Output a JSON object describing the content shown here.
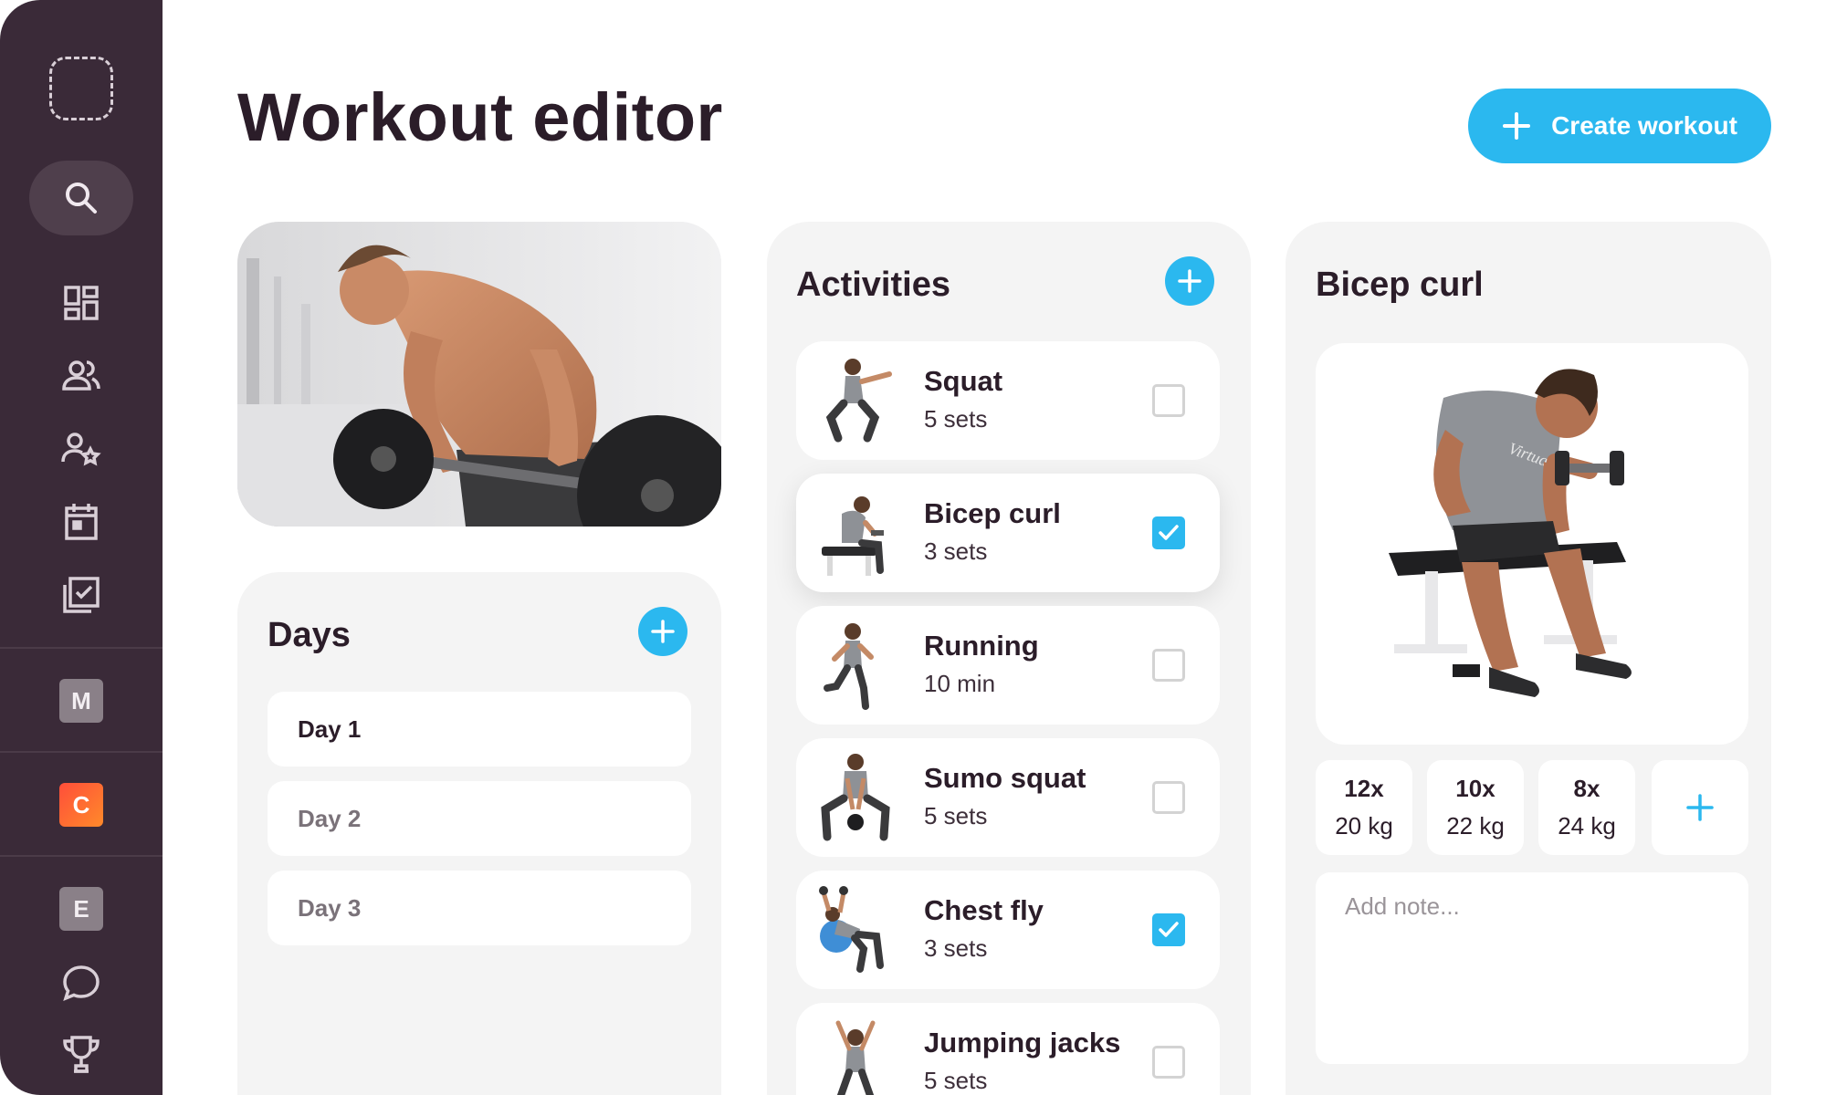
{
  "page": {
    "title": "Workout editor"
  },
  "header": {
    "create_label": "Create workout"
  },
  "sidebar": {
    "badges": [
      "M",
      "C",
      "E"
    ],
    "icons": [
      "logo-placeholder-icon",
      "search-icon",
      "dashboard-icon",
      "clients-icon",
      "favorites-icon",
      "calendar-icon",
      "checklist-icon",
      "chat-icon",
      "trophy-icon"
    ]
  },
  "days": {
    "title": "Days",
    "items": [
      "Day 1",
      "Day 2",
      "Day 3"
    ],
    "selected": "Day 1"
  },
  "activities": {
    "title": "Activities",
    "items": [
      {
        "name": "Squat",
        "detail": "5 sets",
        "checked": false
      },
      {
        "name": "Bicep curl",
        "detail": "3 sets",
        "checked": true
      },
      {
        "name": "Running",
        "detail": "10 min",
        "checked": false
      },
      {
        "name": "Sumo squat",
        "detail": "5 sets",
        "checked": false
      },
      {
        "name": "Chest fly",
        "detail": "3 sets",
        "checked": true
      },
      {
        "name": "Jumping jacks",
        "detail": "5 sets",
        "checked": false
      }
    ]
  },
  "detail": {
    "title": "Bicep curl",
    "shirt_text": "Virtuagym",
    "sets": [
      {
        "reps": "12x",
        "weight": "20 kg"
      },
      {
        "reps": "10x",
        "weight": "22 kg"
      },
      {
        "reps": "8x",
        "weight": "24 kg"
      }
    ],
    "note_placeholder": "Add note..."
  },
  "colors": {
    "accent": "#2bb8ef",
    "sidebar": "#3a2a38",
    "panel": "#f4f4f4",
    "title_text": "#2b1d29"
  }
}
